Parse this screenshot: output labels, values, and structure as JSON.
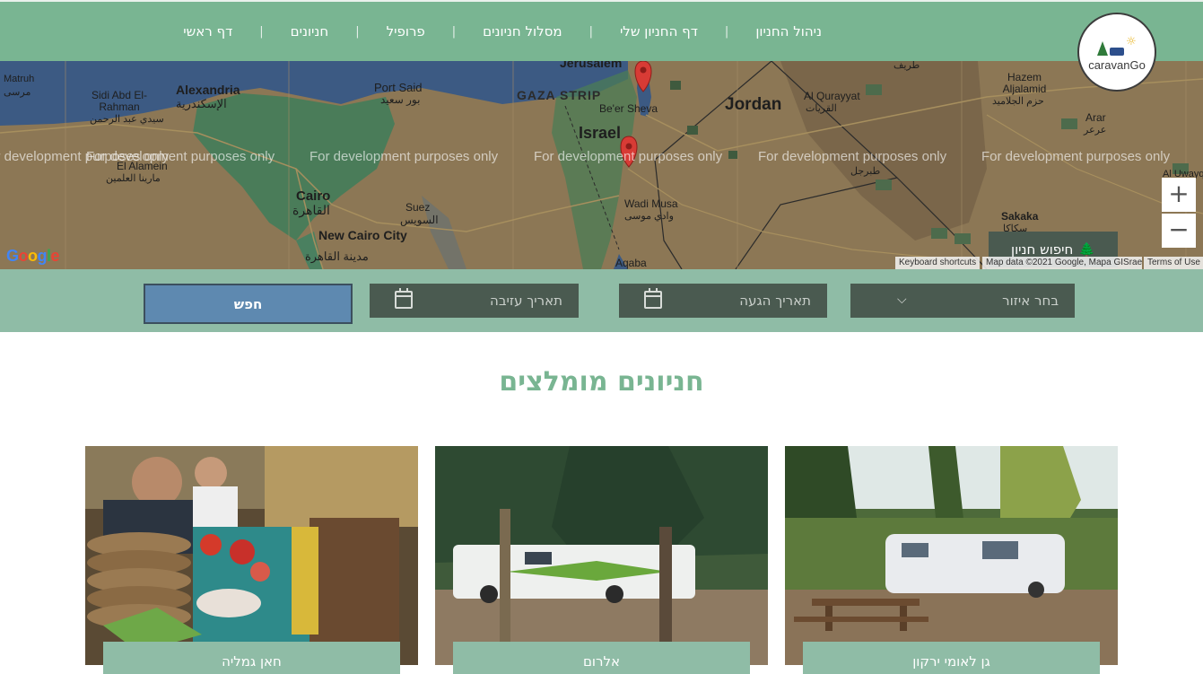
{
  "brand": {
    "logo_text": "caravanGo"
  },
  "nav": {
    "items": [
      {
        "label": "דף ראשי"
      },
      {
        "label": "חניונים"
      },
      {
        "label": "פרופיל"
      },
      {
        "label": "מסלול חניונים"
      },
      {
        "label": "דף החניון שלי"
      },
      {
        "label": "ניהול החניון"
      }
    ]
  },
  "map": {
    "dev_watermark": "For development purposes only",
    "labels": {
      "jordan": "Jordan",
      "israel": "Israel",
      "gaza": "GAZA STRIP",
      "jerusalem": "Jerusalem",
      "beersheva": "Be'er Sheva",
      "alexandria": "Alexandria",
      "alexandria_ar": "الإسكندرية",
      "portsaid": "Port Said",
      "portsaid_ar": "بور سعيد",
      "cairo": "Cairo",
      "cairo_ar": "القاهرة",
      "newcairo": "New Cairo City",
      "newcairo_ar": "مدينة القاهرة",
      "suez": "Suez",
      "suez_ar": "السويس",
      "sidi": "Sidi Abd El-Rahman",
      "sidi_ar": "سيدي عبد الرحمن",
      "matruh": "Matruh",
      "matruh_ar": "مرسى",
      "alamein": "El Alamein",
      "alamein_ar": "مارينا العلمين",
      "wadimusa": "Wadi Musa",
      "wadimusa_ar": "وادي موسى",
      "aqaba": "Aqaba",
      "quryat": "Al Qurayyat",
      "quryat_ar": "القريات",
      "hazem": "Hazem Aljalamid",
      "hazem_ar": "حزم الجلاميد",
      "sakaka": "Sakaka",
      "sakaka_ar": "سكاكا",
      "arar": "Arar",
      "arar_ar": "عرعر",
      "tabarjal": "طبرجل",
      "turaif": "طريف",
      "uwayq": "Al Uwayq"
    },
    "zoom_in": "+",
    "zoom_out": "−",
    "search_camp_label": "חיפוש חניון",
    "attribution": {
      "shortcuts": "Keyboard shortcuts",
      "data": "Map data ©2021 Google, Mapa GISrael",
      "terms": "Terms of Use"
    },
    "google_logo": "Google"
  },
  "search": {
    "region_placeholder": "בחר איזור",
    "arrival_placeholder": "תאריך הגעה",
    "departure_placeholder": "תאריך עזיבה",
    "search_button": "חפש"
  },
  "recommended": {
    "title": "חניונים מומלצים",
    "cards": [
      {
        "name": "גן לאומי ירקון"
      },
      {
        "name": "אלרום"
      },
      {
        "name": "חאן גמליה"
      }
    ]
  }
}
